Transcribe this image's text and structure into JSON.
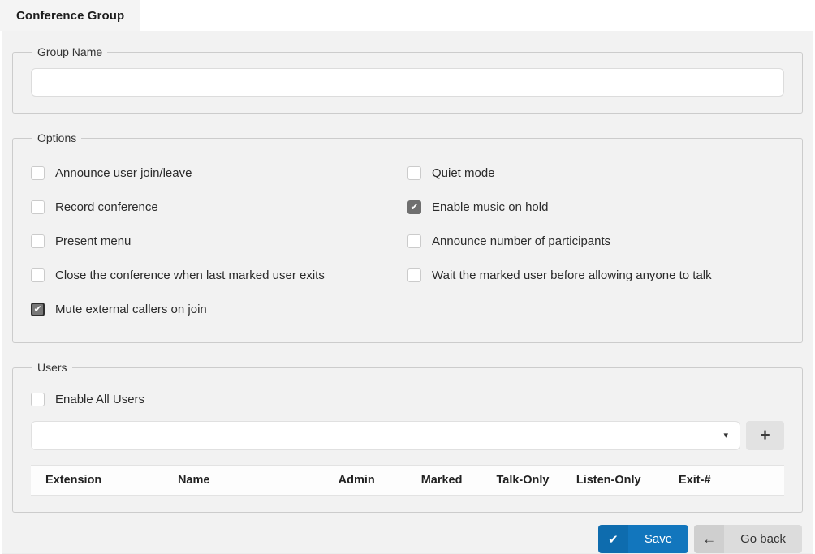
{
  "tab": {
    "label": "Conference Group"
  },
  "group_name": {
    "legend": "Group Name",
    "value": "",
    "placeholder": ""
  },
  "options": {
    "legend": "Options",
    "left": [
      {
        "label": "Announce user join/leave",
        "checked": false
      },
      {
        "label": "Record conference",
        "checked": false
      },
      {
        "label": "Present menu",
        "checked": false
      },
      {
        "label": "Close the conference when last marked user exits",
        "checked": false
      },
      {
        "label": "Mute external callers on join",
        "checked": true,
        "focused": true
      }
    ],
    "right": [
      {
        "label": "Quiet mode",
        "checked": false
      },
      {
        "label": "Enable music on hold",
        "checked": true
      },
      {
        "label": "Announce number of participants",
        "checked": false
      },
      {
        "label": "Wait the marked user before allowing anyone to talk",
        "checked": false
      }
    ]
  },
  "users": {
    "legend": "Users",
    "enable_all": {
      "label": "Enable All Users",
      "checked": false
    },
    "picker": {
      "value": ""
    },
    "add_button": {
      "label": "+"
    },
    "table": {
      "columns": [
        "Extension",
        "Name",
        "Admin",
        "Marked",
        "Talk-Only",
        "Listen-Only",
        "Exit-#"
      ],
      "rows": []
    }
  },
  "actions": {
    "save": {
      "label": "Save"
    },
    "go_back": {
      "label": "Go back"
    }
  },
  "icons": {
    "check": "✔",
    "plus": "+",
    "arrow_left": "←",
    "caret_down": "▾"
  },
  "colors": {
    "accent_blue": "#1276bd",
    "accent_blue_dark": "#0e6cae",
    "checked_gray": "#6f6f6f",
    "panel_bg": "#f2f2f2",
    "button_gray": "#dcdcdc"
  }
}
